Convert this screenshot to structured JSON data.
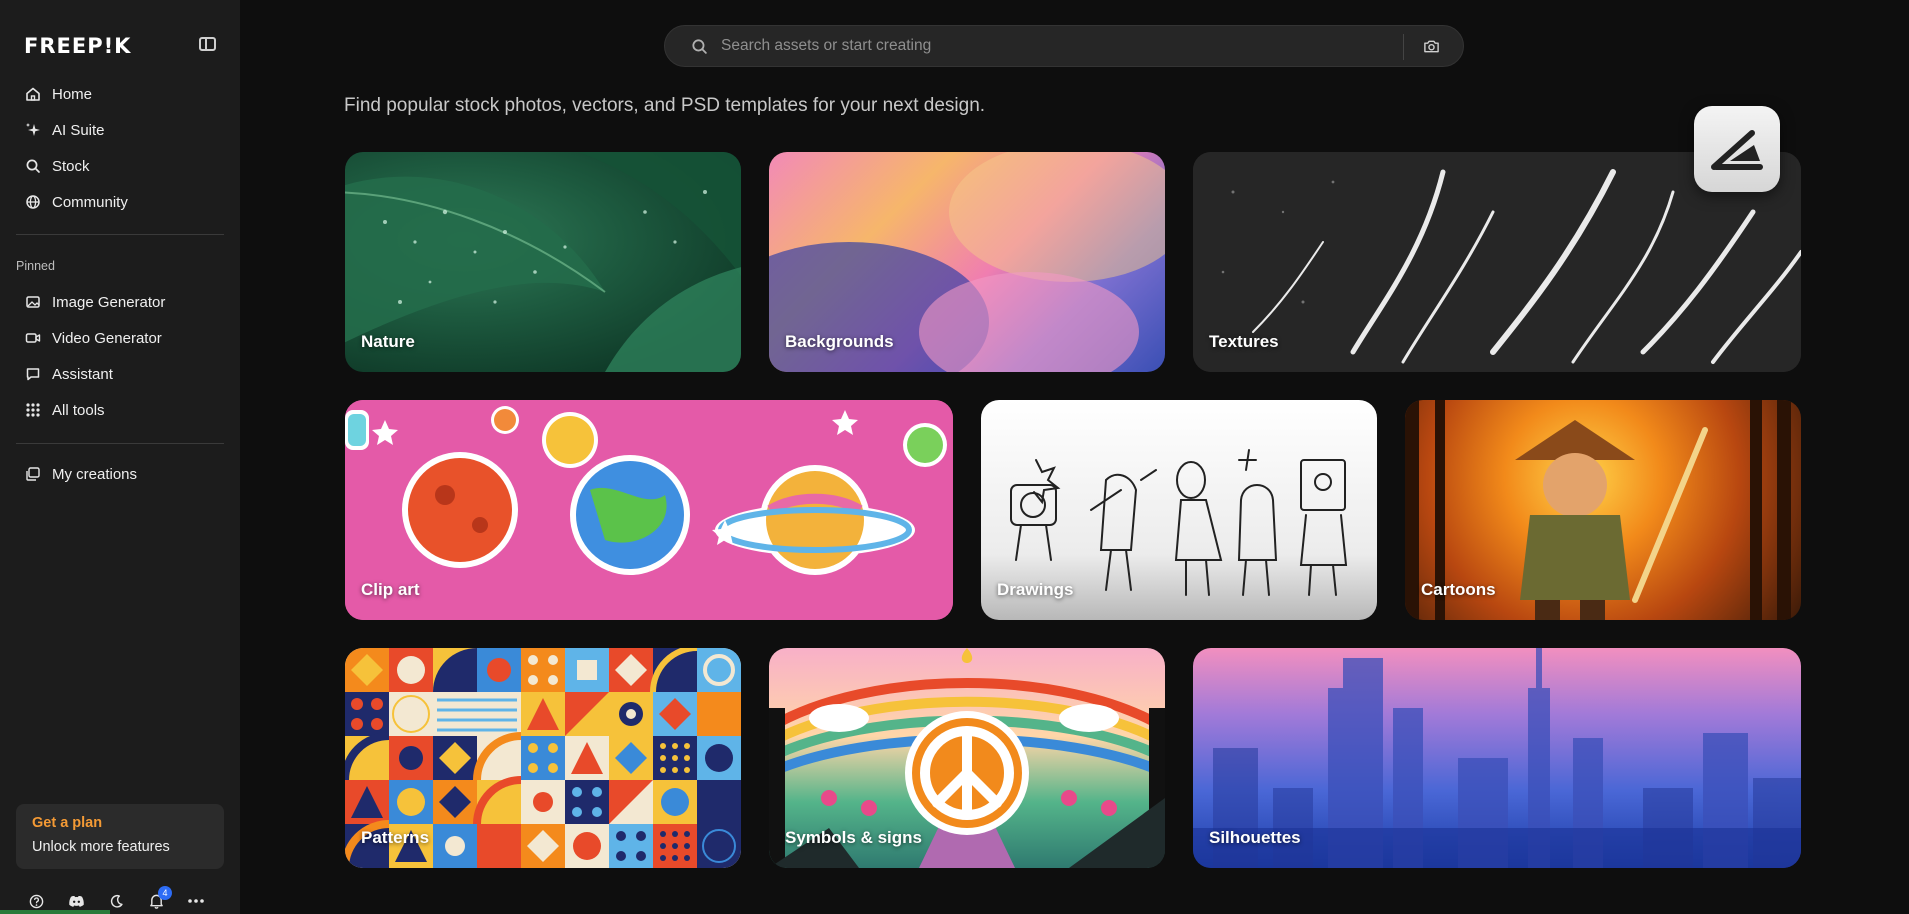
{
  "brand": {
    "logo": "FREEP!K"
  },
  "sidebar": {
    "nav": [
      {
        "label": "Home",
        "icon": "home-icon"
      },
      {
        "label": "AI Suite",
        "icon": "sparkle-icon"
      },
      {
        "label": "Stock",
        "icon": "search-icon"
      },
      {
        "label": "Community",
        "icon": "globe-icon"
      }
    ],
    "pinned_label": "Pinned",
    "pinned": [
      {
        "label": "Image Generator",
        "icon": "image-icon"
      },
      {
        "label": "Video Generator",
        "icon": "video-icon"
      },
      {
        "label": "Assistant",
        "icon": "chat-icon"
      },
      {
        "label": "All tools",
        "icon": "grid-icon"
      }
    ],
    "creations": {
      "label": "My creations",
      "icon": "folder-icon"
    },
    "plan": {
      "title": "Get a plan",
      "subtitle": "Unlock more features"
    },
    "bottom": {
      "notifications_count": "4"
    }
  },
  "search": {
    "placeholder": "Search assets or start creating"
  },
  "tagline": "Find popular stock photos, vectors, and PSD templates for your next design.",
  "categories": [
    {
      "label": "Nature"
    },
    {
      "label": "Backgrounds"
    },
    {
      "label": "Textures"
    },
    {
      "label": "Clip art"
    },
    {
      "label": "Drawings"
    },
    {
      "label": "Cartoons"
    },
    {
      "label": "Patterns"
    },
    {
      "label": "Symbols & signs"
    },
    {
      "label": "Silhouettes"
    }
  ],
  "colors": {
    "accent": "#f49a35",
    "sidebar_bg": "#1c1c1c",
    "page_bg": "#0e0e0e",
    "badge": "#2d6cf5"
  }
}
